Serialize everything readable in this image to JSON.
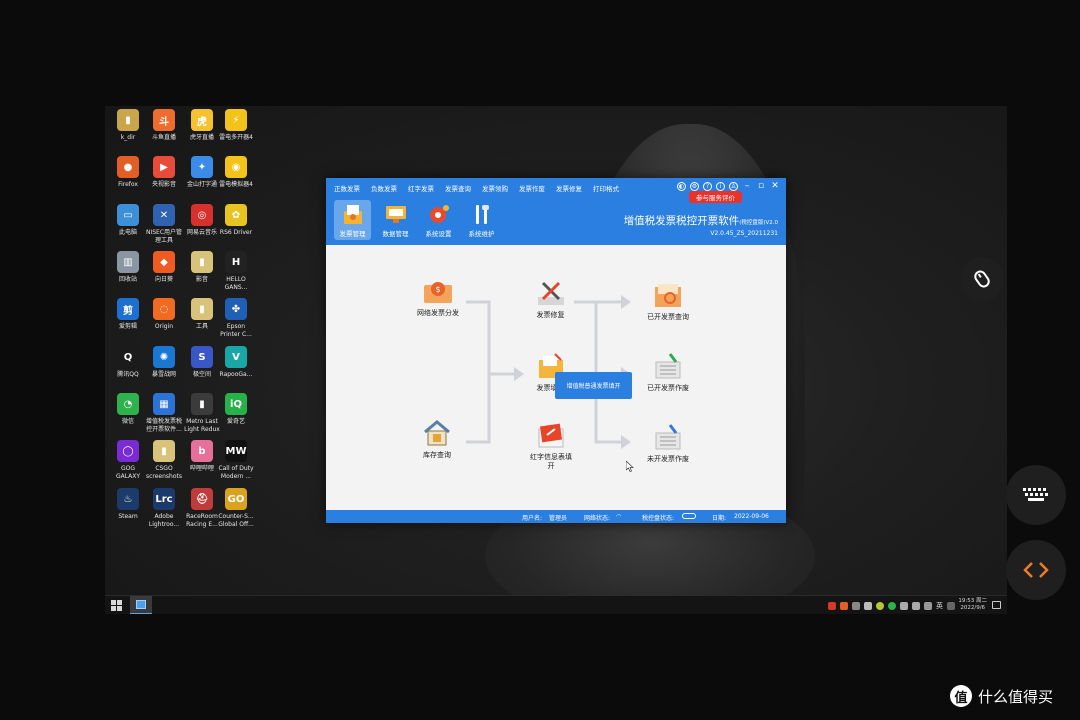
{
  "desktop": {
    "icons": [
      {
        "label": "k_dir",
        "glyph": "▮",
        "color": "#caa64a"
      },
      {
        "label": "斗鱼直播",
        "glyph": "斗",
        "color": "#ef6c2f"
      },
      {
        "label": "虎牙直播",
        "glyph": "虎",
        "color": "#f6c12e"
      },
      {
        "label": "雷电多开器4",
        "glyph": "⚡",
        "color": "#f3c21b"
      },
      {
        "label": "Firefox",
        "glyph": "●",
        "color": "#e35d27"
      },
      {
        "label": "央视影音",
        "glyph": "▶",
        "color": "#e84b3a"
      },
      {
        "label": "金山打字通",
        "glyph": "✦",
        "color": "#3b8be8"
      },
      {
        "label": "雷电模拟器4",
        "glyph": "◉",
        "color": "#f3c21b"
      },
      {
        "label": "此电脑",
        "glyph": "▭",
        "color": "#3d8fd8"
      },
      {
        "label": "NISEC用户管\n理工具",
        "glyph": "✕",
        "color": "#2f62b0"
      },
      {
        "label": "网易云音乐",
        "glyph": "◎",
        "color": "#d8302d"
      },
      {
        "label": "RS6 Driver",
        "glyph": "✿",
        "color": "#e7c421"
      },
      {
        "label": "回收站",
        "glyph": "▥",
        "color": "#8a96a3"
      },
      {
        "label": "向日葵",
        "glyph": "◆",
        "color": "#ef5b22"
      },
      {
        "label": "影音",
        "glyph": "▮",
        "color": "#d9c27a"
      },
      {
        "label": "HELLO\nGANS...",
        "glyph": "H",
        "color": "#222222"
      },
      {
        "label": "爱剪辑",
        "glyph": "剪",
        "color": "#1d6fd0"
      },
      {
        "label": "Origin",
        "glyph": "◌",
        "color": "#f06a22"
      },
      {
        "label": "工具",
        "glyph": "▮",
        "color": "#d9c27a"
      },
      {
        "label": "Epson\nPrinter C...",
        "glyph": "✤",
        "color": "#1f5fb5"
      },
      {
        "label": "腾讯QQ",
        "glyph": "Q",
        "color": "#1b1b1b"
      },
      {
        "label": "暴雪战网",
        "glyph": "✺",
        "color": "#1a78d2"
      },
      {
        "label": "极空间",
        "glyph": "S",
        "color": "#3957c6"
      },
      {
        "label": "RapooGa...",
        "glyph": "V",
        "color": "#1aa6a6"
      },
      {
        "label": "微信",
        "glyph": "◔",
        "color": "#2fb24c"
      },
      {
        "label": "增值税发票税\n控开票软件...",
        "glyph": "▦",
        "color": "#2c73d6"
      },
      {
        "label": "Metro Last\nLight Redux",
        "glyph": "▮",
        "color": "#3b3b3b"
      },
      {
        "label": "爱奇艺",
        "glyph": "iQ",
        "color": "#27b14a"
      },
      {
        "label": "GOG\nGALAXY",
        "glyph": "◯",
        "color": "#7a2bd6"
      },
      {
        "label": "CSGO\nscreenshots",
        "glyph": "▮",
        "color": "#d9c27a"
      },
      {
        "label": "哔哩哔哩",
        "glyph": "b",
        "color": "#e96f9b"
      },
      {
        "label": "Call of Duty\nModern ...",
        "glyph": "MW",
        "color": "#111111"
      },
      {
        "label": "Steam",
        "glyph": "♨",
        "color": "#1b3b6b"
      },
      {
        "label": "Adobe\nLightroo...",
        "glyph": "Lrc",
        "color": "#1b3a6b"
      },
      {
        "label": "RaceRoom\nRacing E...",
        "glyph": "⛑",
        "color": "#c23b3b"
      },
      {
        "label": "Counter-S...\nGlobal Off...",
        "glyph": "GO",
        "color": "#d9a31f"
      }
    ]
  },
  "taskbar": {
    "ime": "英",
    "time": "19:53 周二",
    "date": "2022/9/6"
  },
  "app": {
    "menu": [
      "正数发票",
      "负数发票",
      "红字发票",
      "发票查询",
      "发票领购",
      "发票作废",
      "发票修复",
      "打印格式"
    ],
    "eval_button": "参与服务评价",
    "toolbar": [
      {
        "label": "发票管理",
        "active": true,
        "icon": "invoice-management-icon"
      },
      {
        "label": "数据管理",
        "active": false,
        "icon": "data-management-icon"
      },
      {
        "label": "系统设置",
        "active": false,
        "icon": "system-settings-icon"
      },
      {
        "label": "系统维护",
        "active": false,
        "icon": "system-maintenance-icon"
      }
    ],
    "brand_title": "增值税发票税控开票软件",
    "brand_suffix": "(税控盘版)V2.0",
    "brand_version": "V2.0.45_ZS_20211231",
    "flow": {
      "online_distribution": "网络发票分发",
      "inventory_query": "库存查询",
      "invoice_repair": "发票修复",
      "invoice_fill": "发票填开",
      "red_info_fill": "红字信息表填\n开",
      "issued_query": "已开发票查询",
      "issued_void": "已开发票作废",
      "unissued_void": "未开发票作废"
    },
    "tooltip": "增值税普通发票填开",
    "status": {
      "user_label": "用户名:",
      "user_value": "管理员",
      "network_label": "网络状态:",
      "device_label": "税控盘状态:",
      "date_label": "日期:",
      "date_value": "2022-09-06"
    }
  },
  "watermark": {
    "logo": "值",
    "text": "什么值得买"
  }
}
